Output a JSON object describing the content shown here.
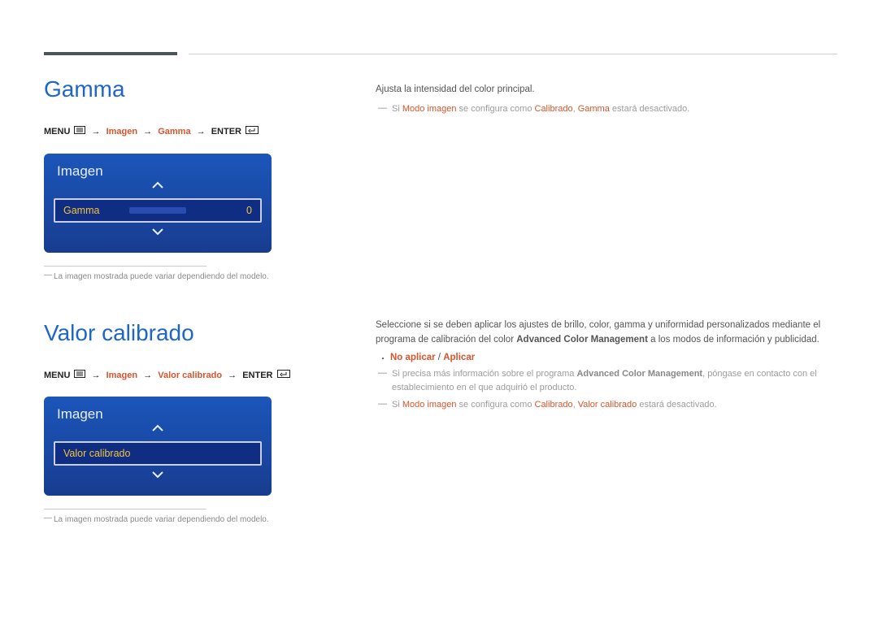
{
  "section1": {
    "title": "Gamma",
    "nav": {
      "menu": "MENU",
      "path1": "Imagen",
      "path2": "Gamma",
      "enter": "ENTER"
    },
    "osd": {
      "panel_title": "Imagen",
      "row_label": "Gamma",
      "row_value": "0"
    },
    "caption": "La imagen mostrada puede variar dependiendo del modelo.",
    "right": {
      "desc": "Ajusta la intensidad del color principal.",
      "note_pre": "Si ",
      "note_hl1": "Modo imagen",
      "note_mid": " se configura como ",
      "note_hl2": "Calibrado",
      "note_sep": ", ",
      "note_hl3": "Gamma",
      "note_end": " estará desactivado."
    }
  },
  "section2": {
    "title": "Valor calibrado",
    "nav": {
      "menu": "MENU",
      "path1": "Imagen",
      "path2": "Valor calibrado",
      "enter": "ENTER"
    },
    "osd": {
      "panel_title": "Imagen",
      "row_label": "Valor calibrado"
    },
    "caption": "La imagen mostrada puede variar dependiendo del modelo.",
    "right": {
      "desc_pre": "Seleccione si se deben aplicar los ajustes de brillo, color, gamma y uniformidad personalizados mediante el programa de calibración del color ",
      "desc_b": "Advanced Color Management",
      "desc_post": " a los modos de información y publicidad.",
      "bullet_a": "No aplicar",
      "bullet_sep": " / ",
      "bullet_b": "Aplicar",
      "note1_pre": "Si precisa más información sobre el programa ",
      "note1_b": "Advanced Color Management",
      "note1_post": ", póngase en contacto con el establecimiento en el que adquirió el producto.",
      "note2_pre": "Si ",
      "note2_hl1": "Modo imagen",
      "note2_mid": " se configura como ",
      "note2_hl2": "Calibrado",
      "note2_sep": ", ",
      "note2_hl3": "Valor calibrado",
      "note2_end": " estará desactivado."
    }
  }
}
